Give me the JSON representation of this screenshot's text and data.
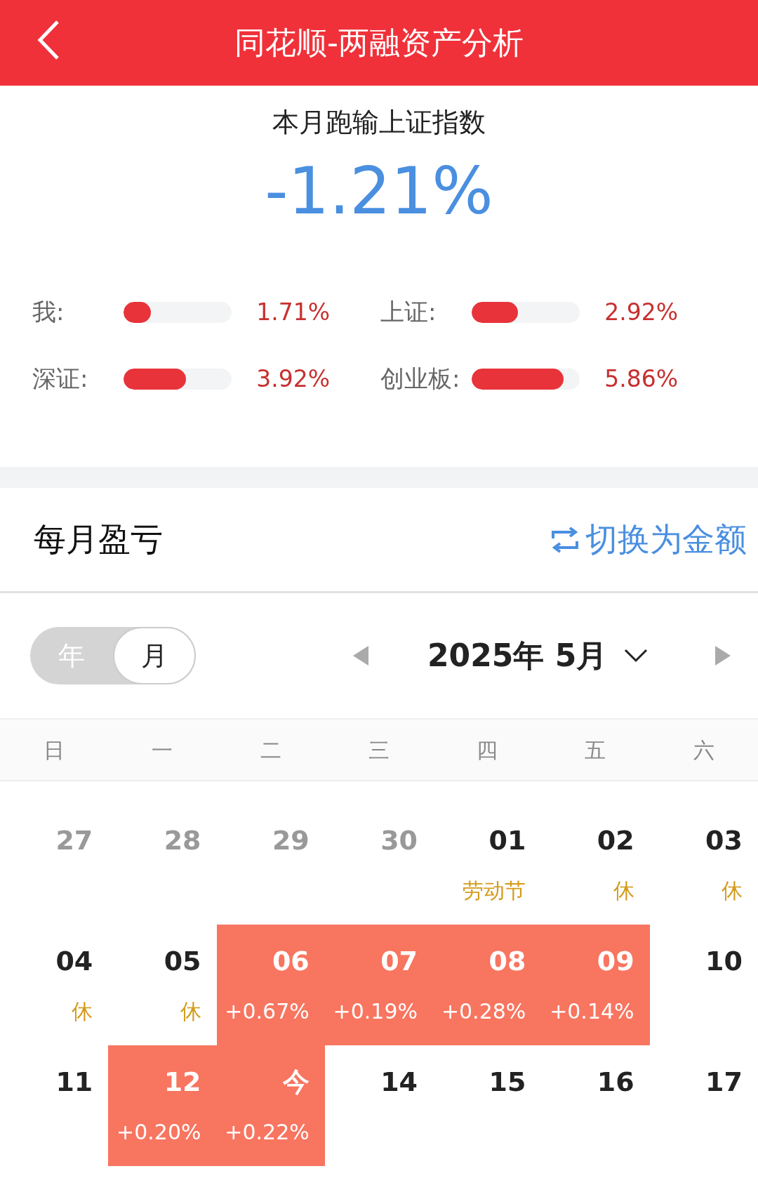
{
  "header": {
    "title": "同花顺-两融资产分析"
  },
  "summary": {
    "caption": "本月跑输上证指数",
    "value": "-1.21%"
  },
  "comparisons": [
    {
      "label": "我:",
      "level": 0.25,
      "reading": "1.71%"
    },
    {
      "label": "上证:",
      "level": 0.43,
      "reading": "2.92%"
    },
    {
      "label": "深证:",
      "level": 0.58,
      "reading": "3.92%"
    },
    {
      "label": "创业板:",
      "level": 0.85,
      "reading": "5.86%"
    }
  ],
  "section": {
    "title": "每月盈亏",
    "switch_link": "切换为金额"
  },
  "view_toggle": [
    {
      "label": "年",
      "selected": false
    },
    {
      "label": "月",
      "selected": true
    }
  ],
  "month": "2025年 5月",
  "weekdays": [
    "日",
    "一",
    "二",
    "三",
    "四",
    "五",
    "六"
  ],
  "days": [
    {
      "day": "27",
      "other_month": true,
      "gain": false
    },
    {
      "day": "28",
      "other_month": true,
      "gain": false
    },
    {
      "day": "29",
      "other_month": true,
      "gain": false
    },
    {
      "day": "30",
      "other_month": true,
      "gain": false
    },
    {
      "day": "01",
      "note": "劳动节",
      "other_month": false,
      "gain": false
    },
    {
      "day": "02",
      "note": "休",
      "other_month": false,
      "gain": false
    },
    {
      "day": "03",
      "note": "休",
      "other_month": false,
      "gain": false
    },
    {
      "day": "04",
      "note": "休",
      "other_month": false,
      "gain": false
    },
    {
      "day": "05",
      "note": "休",
      "other_month": false,
      "gain": false
    },
    {
      "day": "06",
      "note": "+0.67%",
      "other_month": false,
      "gain": true
    },
    {
      "day": "07",
      "note": "+0.19%",
      "other_month": false,
      "gain": true
    },
    {
      "day": "08",
      "note": "+0.28%",
      "other_month": false,
      "gain": true
    },
    {
      "day": "09",
      "note": "+0.14%",
      "other_month": false,
      "gain": true
    },
    {
      "day": "10",
      "other_month": false,
      "gain": false
    },
    {
      "day": "11",
      "other_month": false,
      "gain": false
    },
    {
      "day": "12",
      "note": "+0.20%",
      "other_month": false,
      "gain": true
    },
    {
      "day": "今",
      "note": "+0.22%",
      "other_month": false,
      "gain": true
    },
    {
      "day": "14",
      "other_month": false,
      "gain": false
    },
    {
      "day": "15",
      "other_month": false,
      "gain": false
    },
    {
      "day": "16",
      "other_month": false,
      "gain": false
    },
    {
      "day": "17",
      "other_month": false,
      "gain": false
    }
  ]
}
